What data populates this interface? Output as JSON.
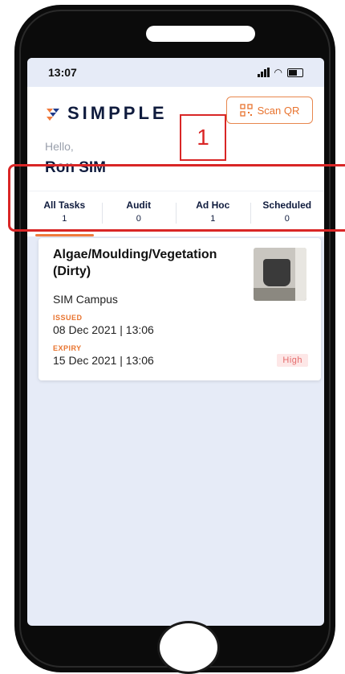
{
  "status_bar": {
    "time": "13:07"
  },
  "header": {
    "brand": "SIMPPLE",
    "scan_label": "Scan QR",
    "greeting": "Hello,",
    "user_name": "Ron SIM"
  },
  "annotation": {
    "number": "1",
    "color": "#d92626"
  },
  "tabs": [
    {
      "label": "All Tasks",
      "count": "1"
    },
    {
      "label": "Audit",
      "count": "0"
    },
    {
      "label": "Ad Hoc",
      "count": "1"
    },
    {
      "label": "Scheduled",
      "count": "0"
    }
  ],
  "active_tab": "All Tasks",
  "accent_color": "#f07a3c",
  "task_card": {
    "title": "Algae/Moulding/Vegetation (Dirty)",
    "location": "SIM Campus",
    "issued_label": "ISSUED",
    "issued_value": "08 Dec 2021 | 13:06",
    "expiry_label": "EXPIRY",
    "expiry_value": "15 Dec 2021 | 13:06",
    "priority": "High"
  },
  "icons": {
    "logo": "simpple-logo-icon",
    "scan": "qr-code-icon",
    "signal": "signal-icon",
    "wifi": "wifi-icon",
    "battery": "battery-icon"
  }
}
